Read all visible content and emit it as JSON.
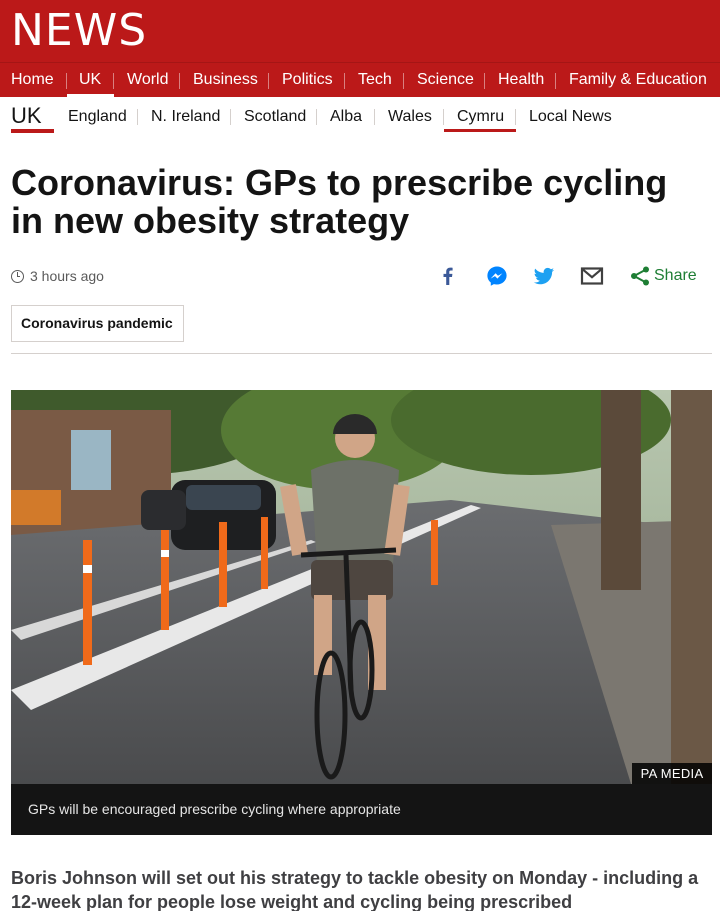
{
  "brand": {
    "logo_text": "NEWS",
    "color": "#bb1919"
  },
  "main_nav": {
    "items": [
      "Home",
      "UK",
      "World",
      "Business",
      "Politics",
      "Tech",
      "Science",
      "Health",
      "Family & Education"
    ],
    "active": "UK"
  },
  "sub_nav": {
    "section": "UK",
    "items": [
      "England",
      "N. Ireland",
      "Scotland",
      "Alba",
      "Wales",
      "Cymru",
      "Local News"
    ],
    "highlighted": "Cymru"
  },
  "article": {
    "headline": "Coronavirus: GPs to prescribe cycling in new obesity strategy",
    "timestamp": "3 hours ago",
    "tag": "Coronavirus pandemic",
    "image": {
      "credit": "PA MEDIA",
      "caption": "GPs will be encouraged prescribe cycling where appropriate"
    },
    "intro": "Boris Johnson will set out his strategy to tackle obesity on Monday - including a 12-week plan for people lose weight and cycling being prescribed"
  },
  "share": {
    "icons": [
      "facebook-icon",
      "messenger-icon",
      "twitter-icon",
      "email-icon",
      "share-icon"
    ],
    "label": "Share",
    "colors": {
      "facebook": "#3b5998",
      "messenger": "#0084ff",
      "twitter": "#1da1f2",
      "email": "#404040",
      "share": "#1e7e34"
    }
  }
}
